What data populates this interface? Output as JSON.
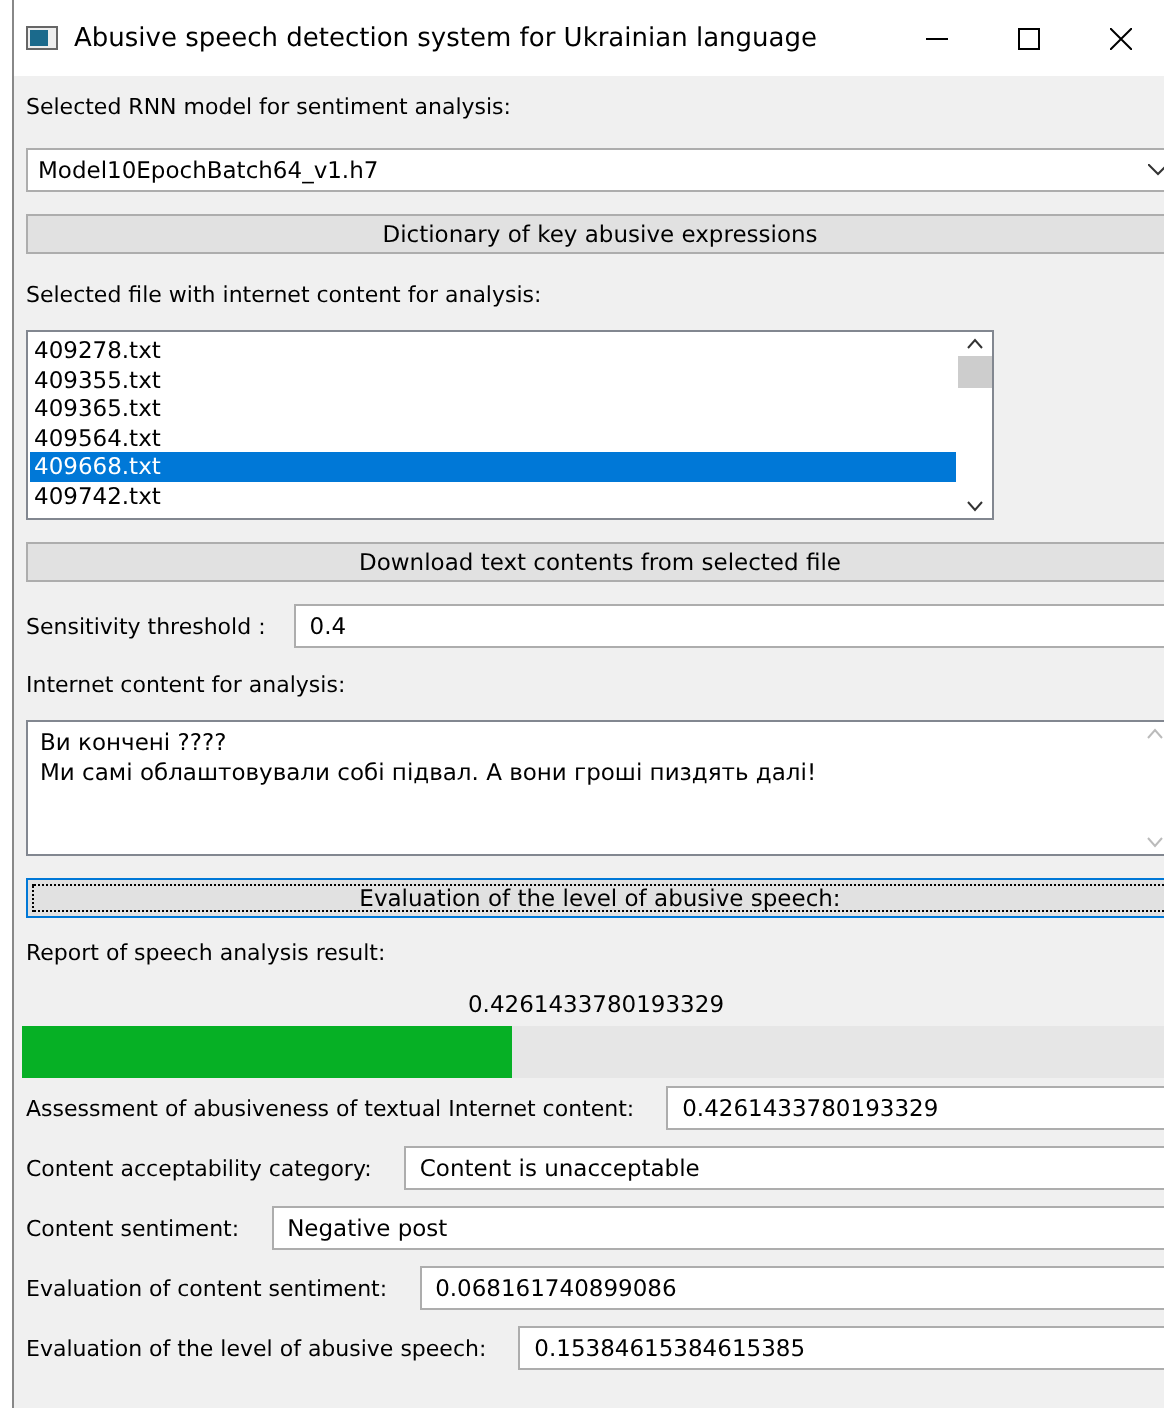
{
  "window": {
    "title": "Abusive speech detection system for Ukrainian language"
  },
  "model": {
    "label": "Selected RNN model for sentiment analysis:",
    "value": "Model10EpochBatch64_v1.h7"
  },
  "dictionary_button": "Dictionary of key abusive expressions",
  "files": {
    "label": "Selected file with internet content for analysis:",
    "items": [
      {
        "name": "409278.txt",
        "selected": false
      },
      {
        "name": "409355.txt",
        "selected": false
      },
      {
        "name": "409365.txt",
        "selected": false
      },
      {
        "name": "409564.txt",
        "selected": false
      },
      {
        "name": "409668.txt",
        "selected": true
      },
      {
        "name": "409742.txt",
        "selected": false
      }
    ]
  },
  "download_button": "Download text contents from selected file",
  "threshold": {
    "label": "Sensitivity threshold :",
    "value": "0.4"
  },
  "content": {
    "label": "Internet content for analysis:",
    "lines": [
      "Ви кончені ????",
      "Ми самі облаштовували собі підвал. А вони гроші пиздять далі!"
    ]
  },
  "evaluate_button": "Evaluation of the level of abusive speech:",
  "report": {
    "label": "Report of speech analysis result:",
    "value": "0.4261433780193329",
    "level": 0.4261
  },
  "results": [
    {
      "label": "Assessment of abusiveness of textual Internet content:",
      "value": "0.4261433780193329"
    },
    {
      "label": "Content acceptability category:",
      "value": "Content is unacceptable"
    },
    {
      "label": "Content sentiment:",
      "value": "Negative post"
    },
    {
      "label": "Evaluation of content sentiment:",
      "value": "0.068161740899086"
    },
    {
      "label": "Evaluation of the level of abusive speech:",
      "value": "0.15384615384615385"
    }
  ]
}
